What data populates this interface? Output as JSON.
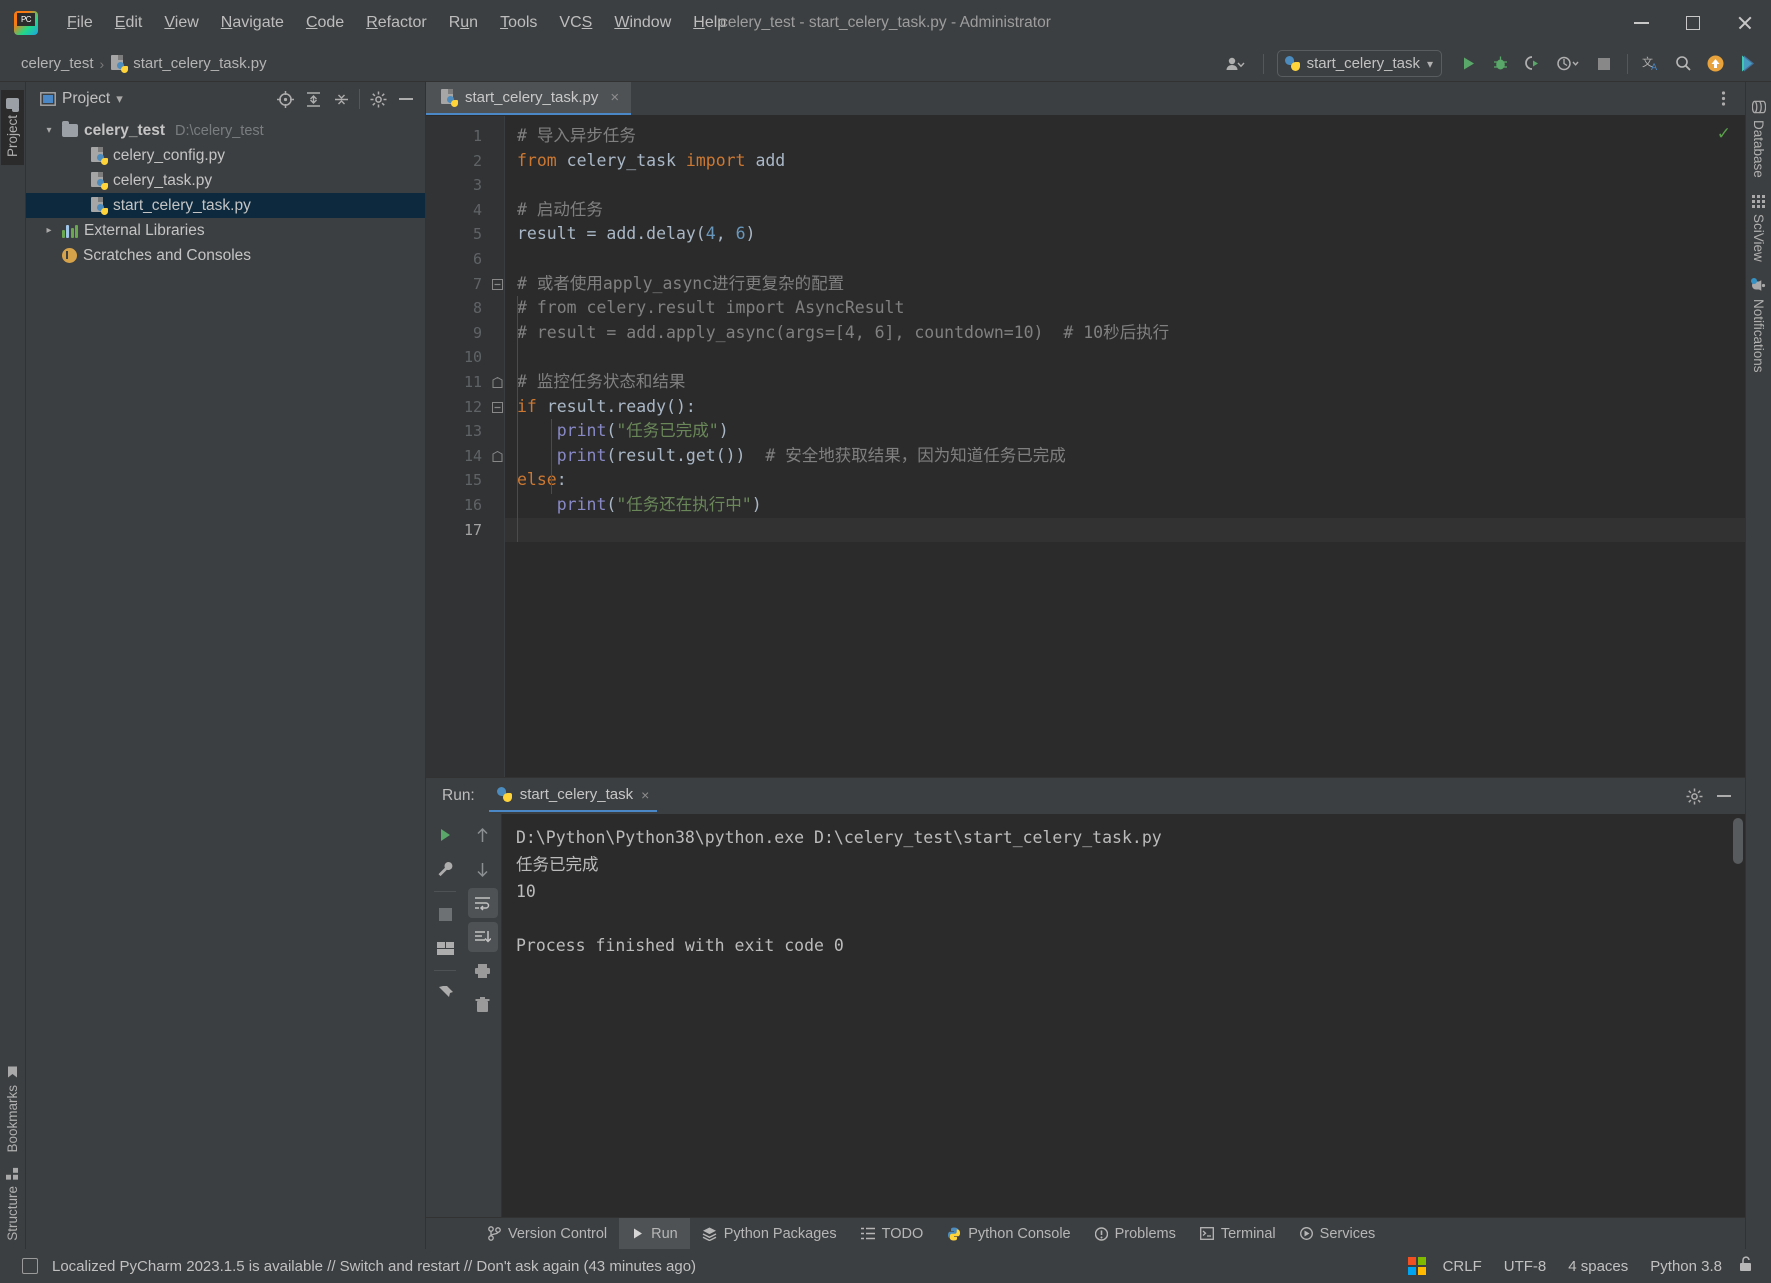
{
  "window": {
    "title": "celery_test - start_celery_task.py - Administrator",
    "app_logo_label": "PC",
    "minimize_label": "Minimize",
    "maximize_label": "Maximize",
    "close_label": "Close"
  },
  "menubar": {
    "items": [
      {
        "label": "File",
        "mnemonic": "F",
        "rest": "ile"
      },
      {
        "label": "Edit",
        "mnemonic": "E",
        "rest": "dit"
      },
      {
        "label": "View",
        "mnemonic": "V",
        "rest": "iew"
      },
      {
        "label": "Navigate",
        "mnemonic": "N",
        "rest": "avigate"
      },
      {
        "label": "Code",
        "mnemonic": "C",
        "rest": "ode"
      },
      {
        "label": "Refactor",
        "mnemonic": "R",
        "rest": "efactor"
      },
      {
        "label": "Run",
        "mnemonic": "u",
        "pre": "R",
        "rest": "n"
      },
      {
        "label": "Tools",
        "mnemonic": "T",
        "rest": "ools"
      },
      {
        "label": "VCS",
        "mnemonic": "S",
        "pre": "VC",
        "rest": ""
      },
      {
        "label": "Window",
        "mnemonic": "W",
        "rest": "indow"
      },
      {
        "label": "Help",
        "mnemonic": "H",
        "rest": "elp"
      }
    ]
  },
  "navbar": {
    "breadcrumb_project": "celery_test",
    "breadcrumb_sep": "›",
    "breadcrumb_file": "start_celery_task.py",
    "run_config_name": "start_celery_task",
    "dropdown_caret": "▾",
    "icons": {
      "user": "user-icon",
      "run": "run-icon",
      "debug": "debug-icon",
      "coverage": "run-with-coverage-icon",
      "profile": "profile-icon",
      "stop": "stop-icon",
      "translate": "translate-icon",
      "search": "search-everywhere-icon",
      "update": "update-icon",
      "ide_feature": "ide-feature-icon"
    }
  },
  "left_strip": {
    "top_tabs": [
      {
        "label": "Project",
        "icon": "folder-icon",
        "active": true
      }
    ],
    "bottom_tabs": [
      {
        "label": "Bookmarks",
        "icon": "bookmark-icon"
      },
      {
        "label": "Structure",
        "icon": "structure-icon"
      }
    ]
  },
  "right_strip": {
    "tabs": [
      {
        "label": "Database",
        "icon": "database-icon"
      },
      {
        "label": "SciView",
        "icon": "sciview-icon"
      },
      {
        "label": "Notifications",
        "icon": "bell-icon",
        "badge": true
      }
    ]
  },
  "project_panel": {
    "title": "Project",
    "title_caret": "▾",
    "toolbar_icons": [
      "locate-icon",
      "expand-all-icon",
      "collapse-all-icon",
      "settings-icon",
      "hide-icon"
    ],
    "tree": [
      {
        "indent": 0,
        "arrow": "⌄",
        "icon": "folder-icon",
        "label": "celery_test",
        "path": "D:\\celery_test",
        "bold": true,
        "selected": false
      },
      {
        "indent": 1,
        "arrow": "",
        "icon": "python-file-icon",
        "label": "celery_config.py",
        "path": "",
        "bold": false,
        "selected": false
      },
      {
        "indent": 1,
        "arrow": "",
        "icon": "python-file-icon",
        "label": "celery_task.py",
        "path": "",
        "bold": false,
        "selected": false
      },
      {
        "indent": 1,
        "arrow": "",
        "icon": "python-file-icon",
        "label": "start_celery_task.py",
        "path": "",
        "bold": false,
        "selected": true
      },
      {
        "indent": 0,
        "arrow": "›",
        "icon": "libraries-icon",
        "label": "External Libraries",
        "path": "",
        "bold": false,
        "selected": false
      },
      {
        "indent": 0,
        "arrow": "",
        "icon": "scratches-icon",
        "label": "Scratches and Consoles",
        "path": "",
        "bold": false,
        "selected": false
      }
    ]
  },
  "editor": {
    "tab_label": "start_celery_task.py",
    "tab_close": "×",
    "options_icon": "more-options-icon",
    "inspection_status": "✓",
    "lines": [
      {
        "n": 1,
        "fold": "",
        "tokens": [
          {
            "t": "# 导入异步任务",
            "c": "c-com"
          }
        ]
      },
      {
        "n": 2,
        "fold": "",
        "tokens": [
          {
            "t": "from ",
            "c": "c-kw"
          },
          {
            "t": "celery_task ",
            "c": "c-txt"
          },
          {
            "t": "import ",
            "c": "c-kw"
          },
          {
            "t": "add",
            "c": "c-txt"
          }
        ]
      },
      {
        "n": 3,
        "fold": "",
        "tokens": []
      },
      {
        "n": 4,
        "fold": "",
        "tokens": [
          {
            "t": "# 启动任务",
            "c": "c-com"
          }
        ]
      },
      {
        "n": 5,
        "fold": "",
        "tokens": [
          {
            "t": "result = add.delay(",
            "c": "c-txt"
          },
          {
            "t": "4",
            "c": "c-num"
          },
          {
            "t": ", ",
            "c": "c-txt"
          },
          {
            "t": "6",
            "c": "c-num"
          },
          {
            "t": ")",
            "c": "c-txt"
          }
        ]
      },
      {
        "n": 6,
        "fold": "",
        "tokens": []
      },
      {
        "n": 7,
        "fold": "start",
        "tokens": [
          {
            "t": "# 或者使用apply_async进行更复杂的配置",
            "c": "c-com"
          }
        ]
      },
      {
        "n": 8,
        "fold": "",
        "tokens": [
          {
            "t": "# from celery.result import AsyncResult",
            "c": "c-com"
          }
        ]
      },
      {
        "n": 9,
        "fold": "",
        "tokens": [
          {
            "t": "# result = add.apply_async(args=[4, 6], countdown=10)  # 10秒后执行",
            "c": "c-com"
          }
        ]
      },
      {
        "n": 10,
        "fold": "",
        "tokens": []
      },
      {
        "n": 11,
        "fold": "end",
        "tokens": [
          {
            "t": "# 监控任务状态和结果",
            "c": "c-com"
          }
        ]
      },
      {
        "n": 12,
        "fold": "start",
        "tokens": [
          {
            "t": "if ",
            "c": "c-kw"
          },
          {
            "t": "result.ready():",
            "c": "c-txt"
          }
        ]
      },
      {
        "n": 13,
        "fold": "",
        "tokens": [
          {
            "t": "    ",
            "c": "c-txt"
          },
          {
            "t": "print",
            "c": "c-fn"
          },
          {
            "t": "(",
            "c": "c-txt"
          },
          {
            "t": "\"任务已完成\"",
            "c": "c-str"
          },
          {
            "t": ")",
            "c": "c-txt"
          }
        ]
      },
      {
        "n": 14,
        "fold": "end",
        "tokens": [
          {
            "t": "    ",
            "c": "c-txt"
          },
          {
            "t": "print",
            "c": "c-fn"
          },
          {
            "t": "(result.get())  ",
            "c": "c-txt"
          },
          {
            "t": "# 安全地获取结果，因为知道任务已完成",
            "c": "c-com"
          }
        ]
      },
      {
        "n": 15,
        "fold": "",
        "tokens": [
          {
            "t": "else",
            "c": "c-kw"
          },
          {
            "t": ":",
            "c": "c-txt"
          }
        ]
      },
      {
        "n": 16,
        "fold": "",
        "tokens": [
          {
            "t": "    ",
            "c": "c-txt"
          },
          {
            "t": "print",
            "c": "c-fn"
          },
          {
            "t": "(",
            "c": "c-txt"
          },
          {
            "t": "\"任务还在执行中\"",
            "c": "c-str"
          },
          {
            "t": ")",
            "c": "c-txt"
          }
        ]
      },
      {
        "n": 17,
        "fold": "",
        "tokens": [],
        "current": true
      }
    ]
  },
  "run_panel": {
    "label": "Run:",
    "tab_label": "start_celery_task",
    "tab_close": "×",
    "settings_icon": "settings-icon",
    "hide_icon": "hide-icon",
    "toolbar_left": [
      "rerun-icon",
      "settings-wrench-icon",
      "stop-icon",
      "layout-icon",
      "pin-icon"
    ],
    "toolbar_right": [
      "up-arrow-icon",
      "down-arrow-icon",
      "soft-wrap-icon",
      "scroll-to-end-icon",
      "print-icon",
      "trash-icon"
    ],
    "console_lines": [
      "D:\\Python\\Python38\\python.exe D:\\celery_test\\start_celery_task.py",
      "任务已完成",
      "10",
      "",
      "Process finished with exit code 0"
    ]
  },
  "bottom_bar": {
    "items": [
      {
        "label": "Version Control",
        "icon": "branch-icon",
        "active": false
      },
      {
        "label": "Run",
        "icon": "run-icon",
        "active": true
      },
      {
        "label": "Python Packages",
        "icon": "packages-icon",
        "active": false
      },
      {
        "label": "TODO",
        "icon": "todo-icon",
        "active": false
      },
      {
        "label": "Python Console",
        "icon": "python-console-icon",
        "active": false
      },
      {
        "label": "Problems",
        "icon": "problems-icon",
        "active": false
      },
      {
        "label": "Terminal",
        "icon": "terminal-icon",
        "active": false
      },
      {
        "label": "Services",
        "icon": "services-icon",
        "active": false
      }
    ]
  },
  "status_bar": {
    "message": "Localized PyCharm 2023.1.5 is available // Switch and restart // Don't ask again (43 minutes ago)",
    "toggle_icon": "toggle-toolwindow-icon",
    "right_items": [
      {
        "label": "CRLF",
        "name": "line-separator"
      },
      {
        "label": "UTF-8",
        "name": "file-encoding"
      },
      {
        "label": "4 spaces",
        "name": "indent-setting"
      },
      {
        "label": "Python 3.8",
        "name": "interpreter"
      }
    ],
    "lock_icon": "unlocked-icon"
  },
  "colors": {
    "accent_blue": "#4a88c7",
    "selection": "#0d293e",
    "editor_bg": "#2b2b2b",
    "panel_bg": "#3c3f41",
    "green": "#5a9e4b",
    "keyword": "#cc7832",
    "string": "#6a8759",
    "number": "#6897bb",
    "comment": "#808080"
  }
}
